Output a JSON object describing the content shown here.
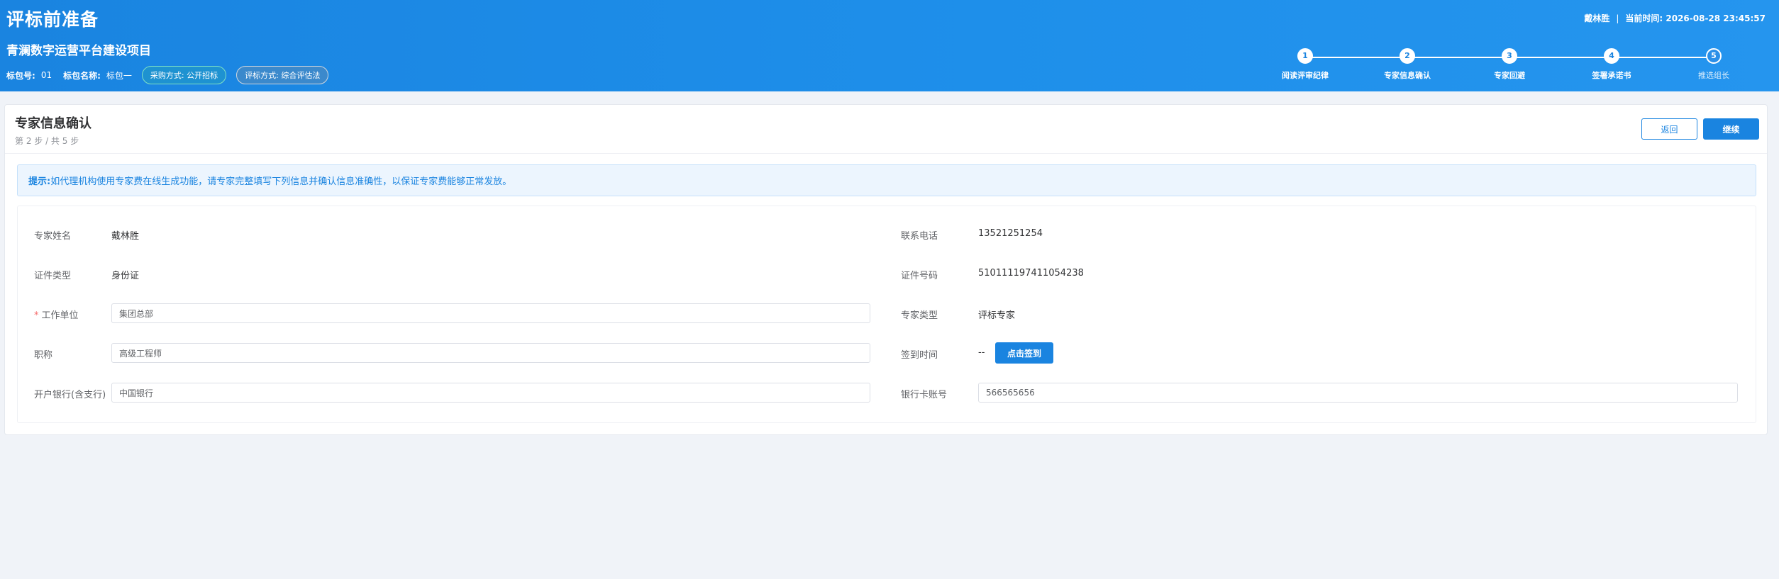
{
  "header": {
    "title": "评标前准备",
    "project_name": "青澜数字运营平台建设项目",
    "package_no_label": "标包号:",
    "package_no": "01",
    "package_name_label": "标包名称:",
    "package_name": "标包一",
    "procurement_method": "采购方式: 公开招标",
    "evaluation_method": "评标方式: 综合评估法",
    "user_name": "戴林胜",
    "separator": "|",
    "current_time": "当前时间: 2026-08-28 23:45:57"
  },
  "stepper": {
    "current_step": 2,
    "steps": [
      {
        "number": "1",
        "label": "阅读评审纪律"
      },
      {
        "number": "2",
        "label": "专家信息确认"
      },
      {
        "number": "3",
        "label": "专家回避"
      },
      {
        "number": "4",
        "label": "签署承诺书"
      },
      {
        "number": "5",
        "label": "推选组长"
      }
    ]
  },
  "card": {
    "title": "专家信息确认",
    "subtitle": "第 2 步 / 共 5 步",
    "back_label": "返回",
    "next_label": "继续"
  },
  "notice": {
    "key": "提示:",
    "text": "如代理机构使用专家费在线生成功能，请专家完整填写下列信息并确认信息准确性，以保证专家费能够正常发放。"
  },
  "form": {
    "expert_name_label": "专家姓名",
    "expert_name": "戴林胜",
    "phone_label": "联系电话",
    "phone": "13521251254",
    "id_type_label": "证件类型",
    "id_type": "身份证",
    "id_number_label": "证件号码",
    "id_number": "510111197411054238",
    "required_mark": "*",
    "work_unit_label": "工作单位",
    "work_unit": "集团总部",
    "expert_type_label": "专家类型",
    "expert_type": "评标专家",
    "title_label": "职称",
    "title_value": "高级工程师",
    "signin_time_label": "签到时间",
    "signin_time": "--",
    "signin_button": "点击签到",
    "bank_label": "开户银行(含支行)",
    "bank": "中国银行",
    "card_no_label": "银行卡账号",
    "card_no": "566565656"
  }
}
